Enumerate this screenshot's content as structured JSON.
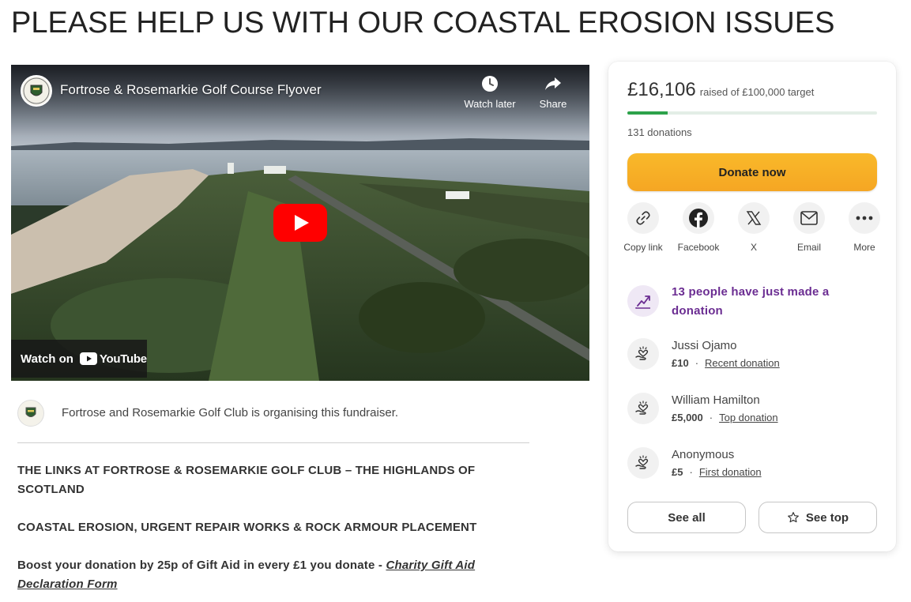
{
  "page": {
    "title": "PLEASE HELP US WITH OUR COASTAL EROSION ISSUES"
  },
  "video": {
    "title": "Fortrose & Rosemarkie Golf Course Flyover",
    "watch_later_label": "Watch later",
    "share_label": "Share",
    "watch_on_label": "Watch on",
    "youtube_label": "YouTube",
    "colors": {
      "play": "#ff0000"
    }
  },
  "organiser": {
    "text": "Fortrose and Rosemarkie Golf Club is organising this fundraiser."
  },
  "description": {
    "heading1": "THE LINKS AT FORTROSE & ROSEMARKIE GOLF CLUB – THE HIGHLANDS OF SCOTLAND",
    "heading2": "COASTAL EROSION, URGENT REPAIR WORKS & ROCK ARMOUR PLACEMENT",
    "gift_aid_text": "Boost your donation by 25p of Gift Aid in every £1 you donate - ",
    "gift_aid_link": "Charity Gift Aid Declaration Form"
  },
  "fundraiser": {
    "raised": "£16,106",
    "target_text": "raised of £100,000 target",
    "progress_fraction": 0.161,
    "donations_count": "131 donations",
    "donate_label": "Donate now",
    "colors": {
      "progress": "#2ca24a",
      "donate": "#f5a623",
      "activity": "#6b2d92"
    }
  },
  "share": [
    {
      "label": "Copy link",
      "icon": "link-icon"
    },
    {
      "label": "Facebook",
      "icon": "facebook-icon"
    },
    {
      "label": "X",
      "icon": "x-icon"
    },
    {
      "label": "Email",
      "icon": "email-icon"
    },
    {
      "label": "More",
      "icon": "more-icon"
    }
  ],
  "activity": {
    "text": "13 people have just made a donation",
    "icon": "trending-up-icon"
  },
  "donors": [
    {
      "name": "Jussi Ojamo",
      "amount": "£10",
      "type": "Recent donation"
    },
    {
      "name": "William Hamilton",
      "amount": "£5,000",
      "type": "Top donation"
    },
    {
      "name": "Anonymous",
      "amount": "£5",
      "type": "First donation"
    }
  ],
  "buttons": {
    "see_all": "See all",
    "see_top": "See top"
  }
}
